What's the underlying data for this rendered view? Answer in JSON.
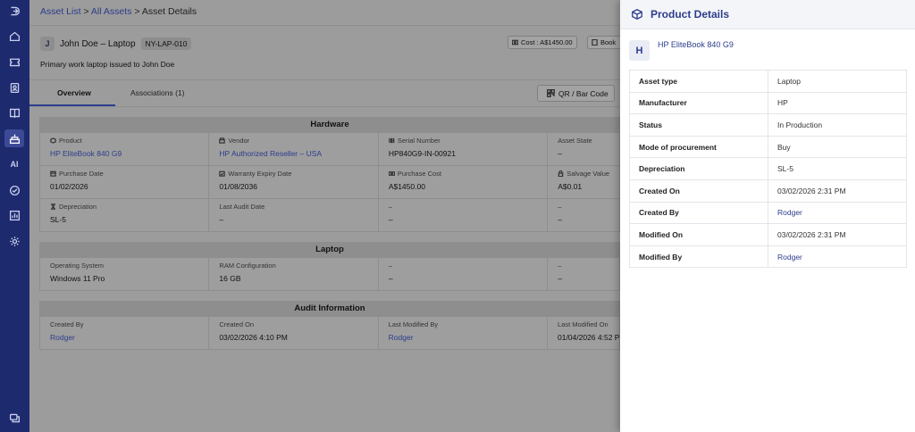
{
  "breadcrumb": {
    "part1": "Asset List",
    "sep1": " > ",
    "part2": "All Assets",
    "sep2": " > ",
    "part3": "Asset Details"
  },
  "asset": {
    "initial": "J",
    "name": "John Doe – Laptop",
    "tag": "NY-LAP-010",
    "description": "Primary work laptop issued to John Doe",
    "cost": "Cost : A$1450.00",
    "book": "Book"
  },
  "tabs": [
    {
      "label": "Overview"
    },
    {
      "label": "Associations (1)"
    }
  ],
  "qr_button": "QR / Bar Code",
  "sections": {
    "hardware": {
      "title": "Hardware",
      "rows": [
        [
          {
            "label": "Product",
            "value": "HP EliteBook 840 G9"
          },
          {
            "label": "Vendor",
            "value": "HP Authorized Reseller – USA"
          },
          {
            "label": "Serial Number",
            "value": "HP840G9-IN-00921"
          },
          {
            "label": "Asset State",
            "value": "–"
          }
        ],
        [
          {
            "label": "Purchase Date",
            "value": "01/02/2026"
          },
          {
            "label": "Warranty Expiry Date",
            "value": "01/08/2036"
          },
          {
            "label": "Purchase Cost",
            "value": "A$1450.00"
          },
          {
            "label": "Salvage Value",
            "value": "A$0.01"
          }
        ],
        [
          {
            "label": "Depreciation",
            "value": "SL-5"
          },
          {
            "label": "Last Audit Date",
            "value": "–"
          },
          {
            "label": "–",
            "value": "–"
          },
          {
            "label": "–",
            "value": "–"
          }
        ]
      ]
    },
    "laptop": {
      "title": "Laptop",
      "rows": [
        [
          {
            "label": "Operating System",
            "value": "Windows 11 Pro"
          },
          {
            "label": "RAM Configuration",
            "value": "16 GB"
          },
          {
            "label": "–",
            "value": "–"
          },
          {
            "label": "–",
            "value": "–"
          }
        ]
      ]
    },
    "audit": {
      "title": "Audit Information",
      "rows": [
        [
          {
            "label": "Created By",
            "value": "Rodger"
          },
          {
            "label": "Created On",
            "value": "03/02/2026 4:10 PM"
          },
          {
            "label": "Last Modified By",
            "value": "Rodger"
          },
          {
            "label": "Last Modified On",
            "value": "01/04/2026 4:52 PM"
          }
        ]
      ]
    }
  },
  "panel": {
    "title": "Product Details",
    "product_initial": "H",
    "product_name": "HP EliteBook 840 G9",
    "rows": [
      {
        "key": "Asset type",
        "value": "Laptop"
      },
      {
        "key": "Manufacturer",
        "value": "HP"
      },
      {
        "key": "Status",
        "value": "In Production"
      },
      {
        "key": "Mode of procurement",
        "value": "Buy"
      },
      {
        "key": "Depreciation",
        "value": "SL-5"
      },
      {
        "key": "Created On",
        "value": "03/02/2026 2:31 PM"
      },
      {
        "key": "Created By",
        "value": "Rodger"
      },
      {
        "key": "Modified On",
        "value": "03/02/2026 2:31 PM"
      },
      {
        "key": "Modified By",
        "value": "Rodger"
      }
    ]
  },
  "sidebar": {
    "ai_label": "AI"
  },
  "colors": {
    "sidebar": "#1e2a6e",
    "accent": "#2d3d8c"
  }
}
